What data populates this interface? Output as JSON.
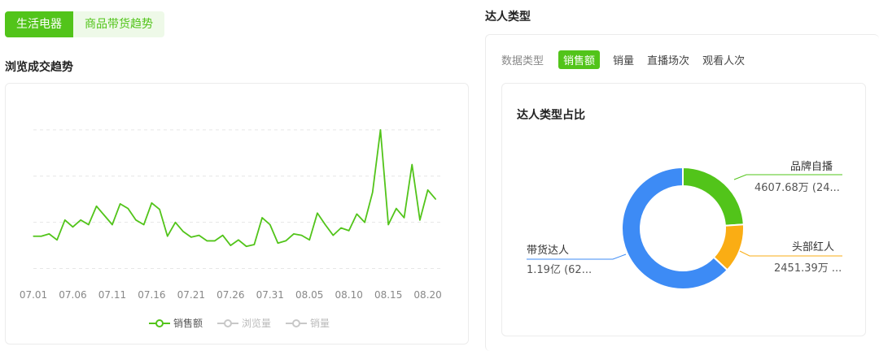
{
  "category_tabs": [
    {
      "label": "生活电器",
      "active": true
    },
    {
      "label": "商品带货趋势",
      "active": false
    }
  ],
  "left_section_title": "浏览成交趋势",
  "right_section_title": "达人类型",
  "data_type_tabs": {
    "prefix": "数据类型",
    "items": [
      "销售额",
      "销量",
      "直播场次",
      "观看人次"
    ],
    "active": "销售额"
  },
  "colors": {
    "accent": "#52c41a",
    "inactive_line": "#c8c8c8",
    "grid": "#e6e6e6",
    "donut_blue": "#3d8bf5",
    "donut_green": "#52c41a",
    "donut_orange": "#faad14"
  },
  "chart_data": [
    {
      "type": "line",
      "title": "",
      "x_tick_labels": [
        "07.01",
        "07.06",
        "07.11",
        "07.16",
        "07.21",
        "07.26",
        "07.31",
        "08.05",
        "08.10",
        "08.15",
        "08.20"
      ],
      "x": [
        "07.01",
        "07.02",
        "07.03",
        "07.04",
        "07.05",
        "07.06",
        "07.07",
        "07.08",
        "07.09",
        "07.10",
        "07.11",
        "07.12",
        "07.13",
        "07.14",
        "07.15",
        "07.16",
        "07.17",
        "07.18",
        "07.19",
        "07.20",
        "07.21",
        "07.22",
        "07.23",
        "07.24",
        "07.25",
        "07.26",
        "07.27",
        "07.28",
        "07.29",
        "07.30",
        "07.31",
        "08.01",
        "08.02",
        "08.03",
        "08.04",
        "08.05",
        "08.06",
        "08.07",
        "08.08",
        "08.09",
        "08.10",
        "08.11",
        "08.12",
        "08.13",
        "08.14",
        "08.15",
        "08.16",
        "08.17",
        "08.18",
        "08.19",
        "08.20",
        "08.21",
        "08.22"
      ],
      "ylim": [
        0,
        4.5
      ],
      "grid": true,
      "y_gridlines": [
        0.5,
        1.5,
        2.5,
        3.5
      ],
      "series": [
        {
          "name": "销售额",
          "active": true,
          "values": [
            1.2,
            1.2,
            1.25,
            1.12,
            1.55,
            1.4,
            1.55,
            1.45,
            1.85,
            1.65,
            1.45,
            1.9,
            1.8,
            1.55,
            1.45,
            1.92,
            1.78,
            1.2,
            1.5,
            1.3,
            1.18,
            1.22,
            1.1,
            1.1,
            1.22,
            1.0,
            1.12,
            0.98,
            1.02,
            1.6,
            1.45,
            1.05,
            1.1,
            1.25,
            1.22,
            1.12,
            1.7,
            1.45,
            1.22,
            1.38,
            1.32,
            1.68,
            1.5,
            2.15,
            3.5,
            1.45,
            1.8,
            1.6,
            2.75,
            1.55,
            2.2,
            2.0
          ]
        },
        {
          "name": "浏览量",
          "active": false
        },
        {
          "name": "销量",
          "active": false
        }
      ]
    },
    {
      "type": "pie",
      "title": "达人类型占比",
      "donut": true,
      "slices": [
        {
          "label": "品牌自播",
          "value_text": "4607.68万 (24...",
          "percent": 24,
          "color": "#52c41a"
        },
        {
          "label": "头部红人",
          "value_text": "2451.39万 ...",
          "percent": 13,
          "color": "#faad14"
        },
        {
          "label": "带货达人",
          "value_text": "1.19亿 (62...",
          "percent": 63,
          "color": "#3d8bf5"
        }
      ]
    }
  ]
}
